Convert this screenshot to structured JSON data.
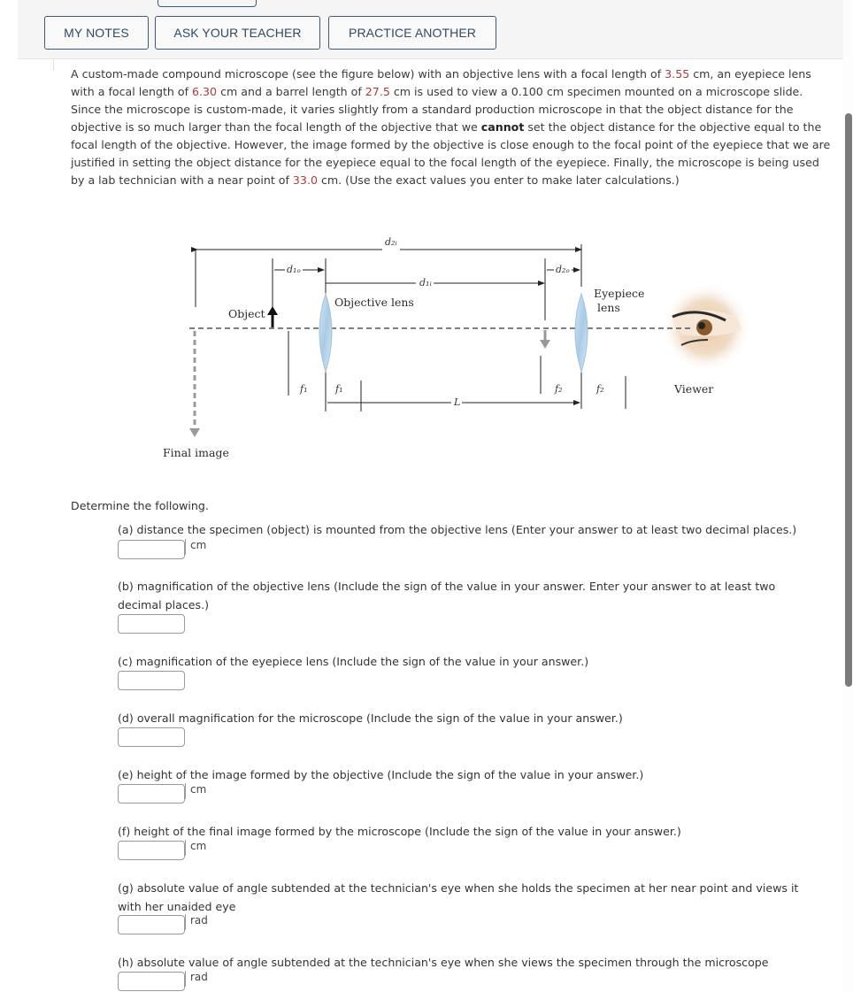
{
  "toolbar": {
    "buttons": {
      "my_notes": "MY NOTES",
      "ask_teacher": "ASK YOUR TEACHER",
      "practice_another": "PRACTICE ANOTHER"
    }
  },
  "problem": {
    "t1": "A custom-made compound microscope (see the figure below) with an objective lens with a focal length of ",
    "f_objective": "3.55",
    "t2": " cm, an eyepiece lens with a focal length of ",
    "f_eyepiece": "6.30",
    "t3": " cm and a barrel length of ",
    "barrel_length": "27.5",
    "t4": " cm is used to view a 0.100 cm specimen mounted on a microscope slide. Since the microscope is custom-made, it varies slightly from a standard production microscope in that the object distance for the objective is so much larger than the focal length of the objective that we ",
    "emphasis": "cannot",
    "t5": " set the object distance for the objective equal to the focal length of the objective. However, the image formed by the objective is close enough to the focal point of the eyepiece that we are justified in setting the object distance for the eyepiece equal to the focal length of the eyepiece. Finally, the microscope is being used by a lab technician with a near point of ",
    "near_point": "33.0",
    "t6": " cm. (Use the exact values you enter to make later calculations.)",
    "value_color": "#b0393b"
  },
  "figure": {
    "labels": {
      "object": "Object",
      "objective_lens": "Objective lens",
      "eyepiece_lens_line1": "Eyepiece",
      "eyepiece_lens_line2": "lens",
      "viewer": "Viewer",
      "final_image": "Final image"
    },
    "symbols": {
      "d2i": "d₂ᵢ",
      "d1o": "d₁ₒ",
      "d1i": "d₁ᵢ",
      "d2o": "d₂ₒ",
      "f1": "f₁",
      "f2": "f₂",
      "L": "L"
    },
    "icons": [
      "objective-lens-icon",
      "eyepiece-lens-icon",
      "eye-icon",
      "object-arrow-icon",
      "intermediate-image-arrow-icon",
      "final-image-arrow-icon"
    ]
  },
  "questions": {
    "intro": "Determine the following.",
    "items": [
      {
        "label": "(a) distance the specimen (object) is mounted from the objective lens (Enter your answer to at least two decimal places.)",
        "unit": "cm",
        "value": ""
      },
      {
        "label": "(b) magnification of the objective lens (Include the sign of the value in your answer. Enter your answer to at least two decimal places.)",
        "unit": "",
        "value": ""
      },
      {
        "label": "(c) magnification of the eyepiece lens (Include the sign of the value in your answer.)",
        "unit": "",
        "value": ""
      },
      {
        "label": "(d) overall magnification for the microscope (Include the sign of the value in your answer.)",
        "unit": "",
        "value": ""
      },
      {
        "label": "(e) height of the image formed by the objective (Include the sign of the value in your answer.)",
        "unit": "cm",
        "value": ""
      },
      {
        "label": "(f) height of the final image formed by the microscope (Include the sign of the value in your answer.)",
        "unit": "cm",
        "value": ""
      },
      {
        "label": "(g) absolute value of angle subtended at the technician's eye when she holds the specimen at her near point and views it with her unaided eye",
        "unit": "rad",
        "value": ""
      },
      {
        "label": "(h) absolute value of angle subtended at the technician's eye when she views the specimen through the microscope",
        "unit": "rad",
        "value": ""
      }
    ]
  }
}
